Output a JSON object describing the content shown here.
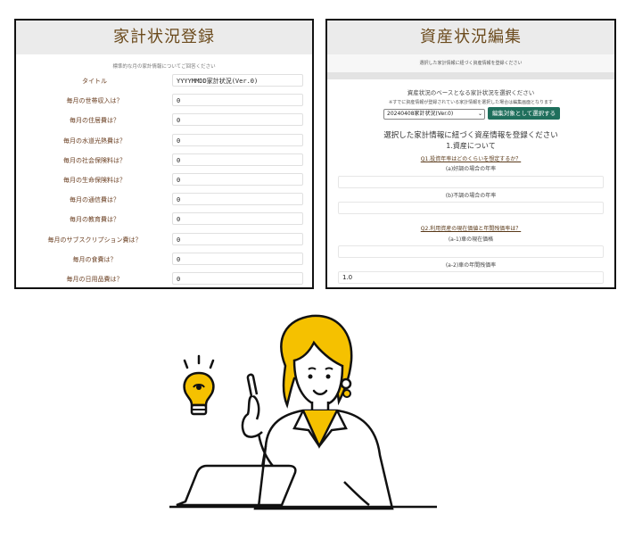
{
  "left": {
    "title": "家計状況登録",
    "subtitle": "標準的な月の家計情報についてご回答ください",
    "rows": [
      {
        "label": "タイトル",
        "value": "YYYYMMDD家計状況(Ver.0)"
      },
      {
        "label": "毎月の世帯収入は？",
        "value": "0"
      },
      {
        "label": "毎月の住居費は？",
        "value": "0"
      },
      {
        "label": "毎月の水道光熱費は？",
        "value": "0"
      },
      {
        "label": "毎月の社会保険料は？",
        "value": "0"
      },
      {
        "label": "毎月の生命保険料は？",
        "value": "0"
      },
      {
        "label": "毎月の通信費は？",
        "value": "0"
      },
      {
        "label": "毎月の教育費は？",
        "value": "0"
      },
      {
        "label": "毎月のサブスクリプション費は？",
        "value": "0"
      },
      {
        "label": "毎月の食費は？",
        "value": "0"
      },
      {
        "label": "毎月の日用品費は？",
        "value": "0"
      }
    ]
  },
  "right": {
    "title": "資産状況編集",
    "subbar": "選択した家計情報に紐づく資産情報を登録ください",
    "base_heading": "資産状況のベースとなる家計状況を選択ください",
    "note": "※すでに資産情報が登録されている家計情報を選択した場合は編集画面となります",
    "select_value": "20240408家計状況(Ver.0)",
    "select_button": "編集対象として選択する",
    "section_heading": "選択した家計情報に紐づく資産情報を登録ください",
    "section_title": "1.資産について",
    "q1": "Q1.投資年率はどのくらいを想定するか？",
    "q1a": "(a)好調の場合の年率",
    "q1a_value": "",
    "q1b": "(b)不調の場合の年率",
    "q1b_value": "",
    "q2": "Q2.利用資産の現在価値と年間残価率は？",
    "q2a1": "(a-1)車の現在価格",
    "q2a1_value": "",
    "q2a2": "(a-2)車の年間残価率",
    "q2a2_value": "1.0"
  },
  "colors": {
    "accent_button": "#1f6f5c",
    "title_text": "#6b4a1c",
    "illustration_yellow": "#f5c100"
  },
  "icons": [
    "lightbulb-icon"
  ]
}
